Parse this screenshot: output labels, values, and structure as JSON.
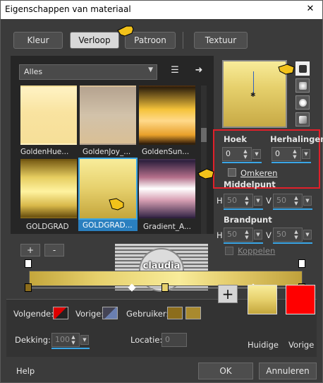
{
  "window": {
    "title": "Eigenschappen van materiaal",
    "close": "✕"
  },
  "tabs": [
    {
      "label": "Kleur"
    },
    {
      "label": "Verloop"
    },
    {
      "label": "Patroon"
    },
    {
      "label": "Textuur"
    }
  ],
  "category": {
    "value": "Alles"
  },
  "gradients": [
    {
      "label": "GoldenHue..."
    },
    {
      "label": "GoldenJoy_..."
    },
    {
      "label": "GoldenSun..."
    },
    {
      "label": "GOLDGRAD"
    },
    {
      "label": "GOLDGRAD..."
    },
    {
      "label": "Gradient_A..."
    }
  ],
  "gallery_buttons": {
    "add": "+",
    "remove": "-"
  },
  "settings": {
    "hoek_label": "Hoek",
    "hoek_value": "0",
    "herhalingen_label": "Herhalingen",
    "herhalingen_value": "0",
    "omkeren_label": "Omkeren",
    "middelpunt_label": "Middelpunt",
    "mid_h_label": "H",
    "mid_h_value": "50",
    "mid_v_label": "V",
    "mid_v_value": "50",
    "brandpunt_label": "Brandpunt",
    "brand_h_label": "H",
    "brand_h_value": "50",
    "brand_v_label": "V",
    "brand_v_value": "50",
    "koppelen_label": "Koppelen"
  },
  "bottom": {
    "volgende_label": "Volgende:",
    "vorige_label": "Vorige:",
    "gebruiker_label": "Gebruiker:",
    "dekking_label": "Dekking:",
    "dekking_value": "100",
    "locatie_label": "Locatie:",
    "locatie_value": "0",
    "huidige_label": "Huidige",
    "vorige_swatch_label": "Vorige",
    "add_symbol": "+"
  },
  "watermark": {
    "text": "claudia"
  },
  "footer": {
    "help": "Help",
    "ok": "OK",
    "cancel": "Annuleren"
  },
  "colors": {
    "gold_light": "#f8ec9a",
    "gold_dark": "#c4a63c",
    "selection_blue": "#3aa6e6",
    "highlight_red": "#e0202a",
    "vorige_red": "#ff0000"
  }
}
